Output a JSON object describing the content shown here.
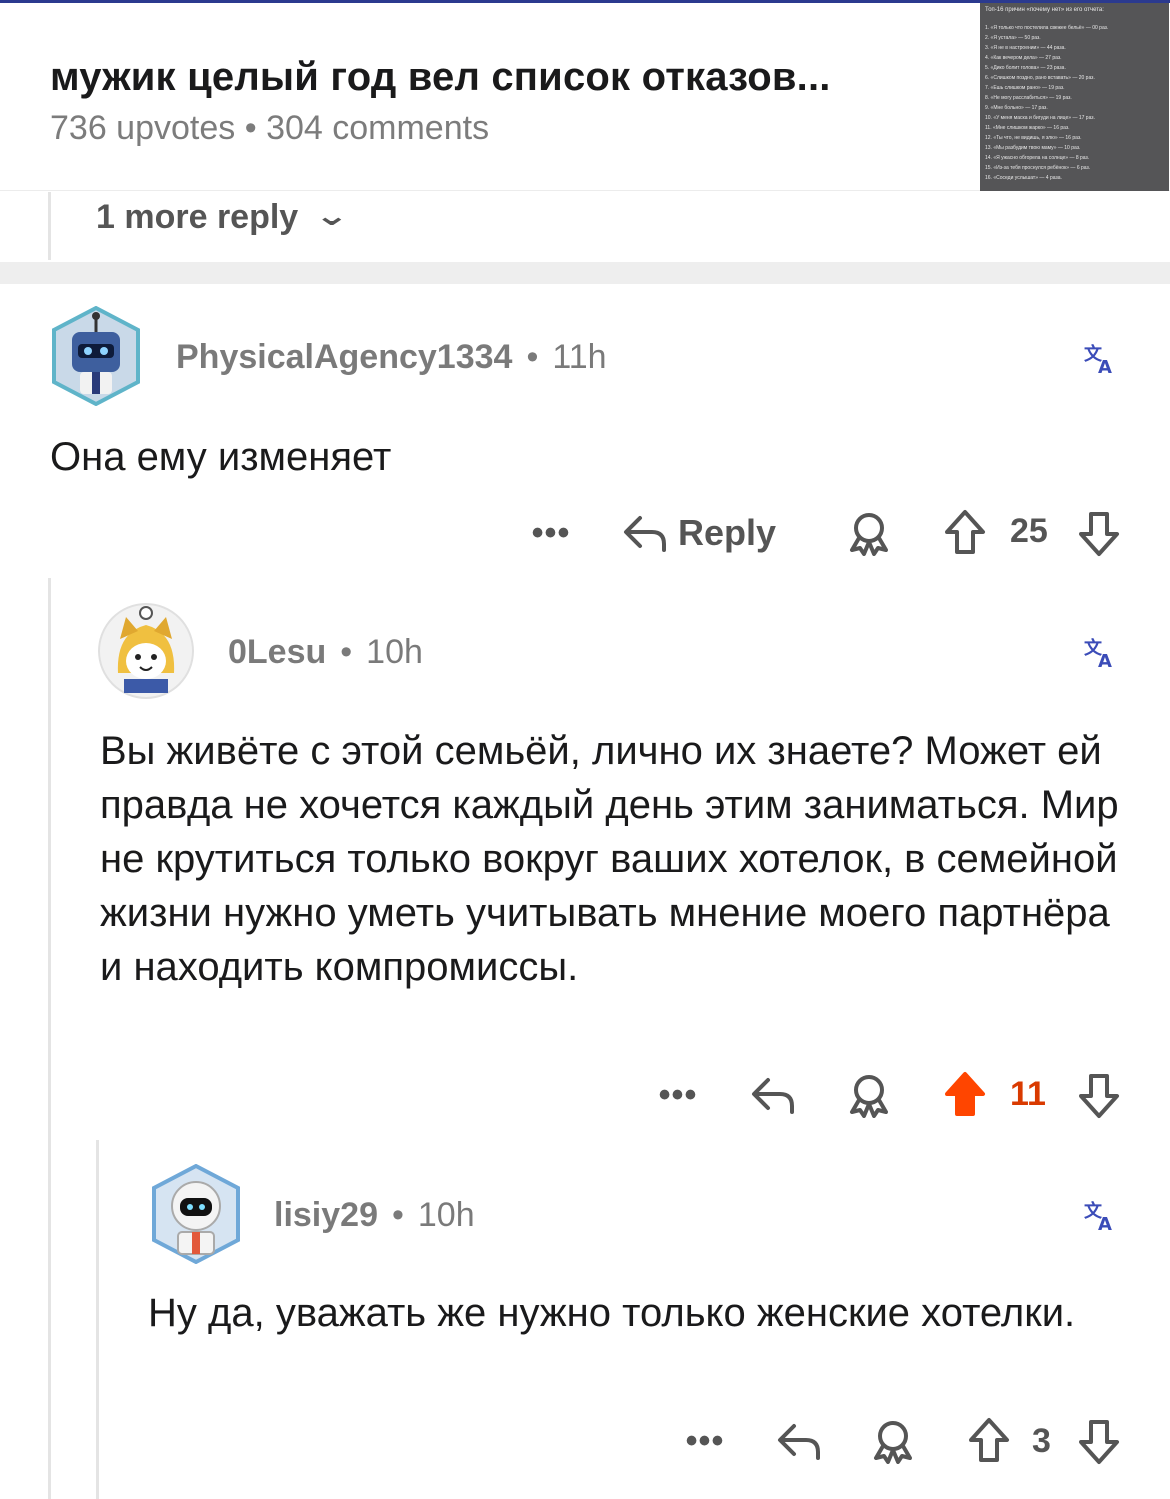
{
  "post": {
    "title": "мужик целый год вел список отказов...",
    "upvotes": "736 upvotes",
    "separator": "•",
    "comments": "304 comments",
    "thumbnail": {
      "title": "Топ-16 причин «почему нет» из его отчета:",
      "lines": [
        "1. «Я только что постелила свежее бельё» — 00 раз.",
        "2. «Я устала» — 50 раз.",
        "3. «Я не в настроении» — 44 раза.",
        "4. «Как вечером дела» — 27 раз.",
        "5. «Дико болит голова» — 23 раза.",
        "6. «Слишком поздно, рано вставать» — 20 раз.",
        "7. «Ешь слишком рано» — 19 раз.",
        "8. «Не могу расслабиться» — 19 раз.",
        "9. «Мне больно» — 17 раз.",
        "10. «У меня маска и бигуди на лице» — 17 раз.",
        "11. «Мне слишком жарко» — 16 раз.",
        "12. «Ты что, не видишь, я злю» — 16 раз.",
        "13. «Мы разбудим твою маму» — 10 раз.",
        "14. «Я ужасно обгорела на солнце» — 8 раз.",
        "15. «Из-за тебя проснулся ребёнок» — 6 раз.",
        "16. «Соседи услышат» — 4 раза."
      ]
    }
  },
  "more_replies": {
    "label": "1 more reply",
    "icon": "chevron-down-icon"
  },
  "comments": [
    {
      "username": "PhysicalAgency1334",
      "age": "11h",
      "body": "Она ему изменяет",
      "reply_label": "Reply",
      "more": "•••",
      "score": "25",
      "upvoted": false
    },
    {
      "username": "0Lesu",
      "age": "10h",
      "body": "Вы живёте с этой семьёй, лично их знаете? Может ей правда не хочется каждый день этим заниматься. Мир не крутиться только вокруг ваших хотелок, в семейной жизни нужно уметь учитывать мнение моего партнёра и находить компромиссы.",
      "more": "•••",
      "score": "11",
      "upvoted": true
    },
    {
      "username": "lisiy29",
      "age": "10h",
      "body": "Ну да, уважать же нужно только женские хотелки.",
      "more": "•••",
      "score": "3",
      "upvoted": false
    }
  ],
  "colors": {
    "upvote_active": "#ff4500",
    "upvote_count_active": "#d93a00",
    "meta_gray": "#7c7c7c",
    "translate_blue": "#3b4cb8"
  }
}
